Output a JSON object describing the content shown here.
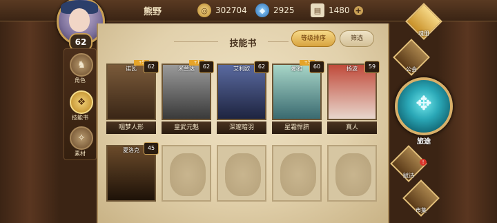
{
  "player": {
    "name": "熊野",
    "level": "62"
  },
  "resources": [
    {
      "icon": "gold-coin-icon",
      "value": "302704"
    },
    {
      "icon": "crystal-icon",
      "value": "2925"
    },
    {
      "icon": "scroll-icon",
      "value": "1480"
    }
  ],
  "left_tabs": [
    {
      "label": "角色",
      "icon": "character-tab-icon"
    },
    {
      "label": "技能书",
      "icon": "skillbook-tab-icon",
      "active": true
    },
    {
      "label": "素材",
      "icon": "material-tab-icon"
    }
  ],
  "panel": {
    "title": "技能书",
    "sort_label": "等级排序",
    "filter_label": "筛选"
  },
  "cards": [
    {
      "name": "诺瓦",
      "level": "62",
      "badge": "+5",
      "skill": "咽梦人形"
    },
    {
      "name": "米兰达",
      "level": "62",
      "badge": "+1",
      "skill": "皇武元魁"
    },
    {
      "name": "艾利欧",
      "level": "62",
      "badge": "",
      "skill": "深邃暗羽"
    },
    {
      "name": "娜雅",
      "level": "60",
      "badge": "+3",
      "skill": "星霜悍脐"
    },
    {
      "name": "扬波",
      "level": "59",
      "badge": "",
      "skill": "真人"
    },
    {
      "name": "夏洛克",
      "level": "45",
      "badge": "",
      "skill": ""
    }
  ],
  "right_menu": [
    {
      "label": "魂册",
      "icon": "soul-book-icon"
    },
    {
      "label": "公会",
      "icon": "guild-icon"
    },
    {
      "label": "旅途",
      "icon": "journey-icon"
    },
    {
      "label": "赋诗",
      "icon": "poem-icon"
    },
    {
      "label": "市集",
      "icon": "market-icon"
    }
  ]
}
